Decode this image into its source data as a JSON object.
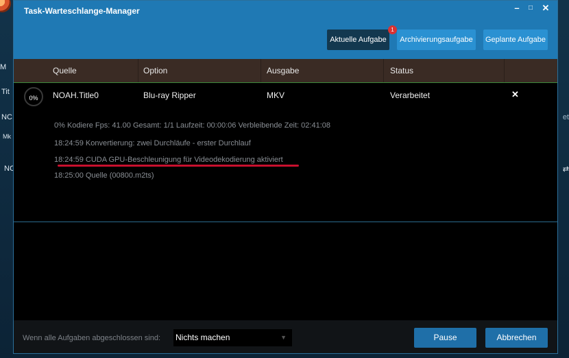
{
  "background": {
    "left_items": [
      "M",
      "Tit",
      "NC",
      "Mk",
      "NC"
    ],
    "right_items": [
      "et",
      "⇄"
    ]
  },
  "window": {
    "title": "Task-Warteschlange-Manager",
    "controls": {
      "minimize": "–",
      "maximize": "□",
      "close": "✕"
    }
  },
  "tabs": [
    {
      "label": "Aktuelle Aufgabe",
      "active": true,
      "badge": "1"
    },
    {
      "label": "Archivierungsaufgabe",
      "active": false
    },
    {
      "label": "Geplante Aufgabe",
      "active": false
    }
  ],
  "table": {
    "headers": [
      "Quelle",
      "Option",
      "Ausgabe",
      "Status"
    ],
    "row": {
      "progress": "0%",
      "source": "NOAH.Title0",
      "option": "Blu-ray Ripper",
      "output": "MKV",
      "status": "Verarbeitet",
      "remove_icon": "✕"
    },
    "log": [
      "0%  Kodiere Fps: 41.00   Gesamt: 1/1   Laufzeit: 00:00:06   Verbleibende Zeit: 02:41:08",
      "18:24:59    Konvertierung: zwei Durchläufe - erster Durchlauf",
      "18:24:59    CUDA GPU-Beschleunigung für Videodekodierung aktiviert",
      "18:25:00    Quelle (00800.m2ts)"
    ]
  },
  "footer": {
    "label": "Wenn alle Aufgaben abgeschlossen sind:",
    "select_value": "Nichts machen",
    "pause_label": "Pause",
    "cancel_label": "Abbrechen"
  },
  "colors": {
    "titlebar": "#1f79b4",
    "tab": "#2a91d2",
    "tab_active": "#13384f",
    "highlight_underline": "#c8102e",
    "button": "#1f6fa8"
  }
}
